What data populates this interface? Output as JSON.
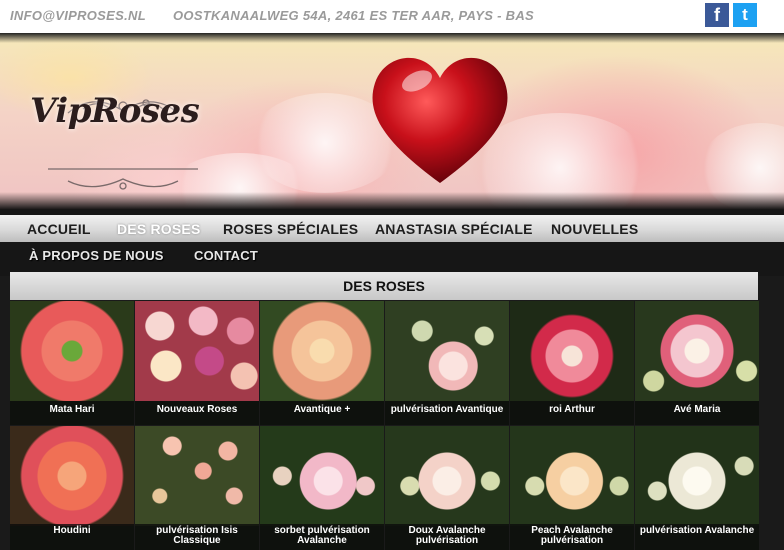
{
  "topbar": {
    "email": "INFO@VIPROSES.NL",
    "address": "OOSTKANAALWEG 54A, 2461 ES TER AAR, PAYS - BAS",
    "facebook_glyph": "f",
    "twitter_glyph": "t"
  },
  "brand": {
    "logo_text": "VipRoses"
  },
  "nav": {
    "row1": [
      "ACCUEIL",
      "DES ROSES",
      "ROSES SPÉCIALES",
      "ANASTASIA SPÉCIALE",
      "NOUVELLES"
    ],
    "row2": [
      "À PROPOS DE NOUS",
      "CONTACT"
    ],
    "active": "DES ROSES"
  },
  "section": {
    "title": "DES ROSES"
  },
  "products": [
    {
      "name": "Mata Hari"
    },
    {
      "name": "Nouveaux Roses"
    },
    {
      "name": "Avantique +"
    },
    {
      "name": "pulvérisation Avantique"
    },
    {
      "name": "roi Arthur"
    },
    {
      "name": "Avé Maria"
    },
    {
      "name": "Houdini"
    },
    {
      "name": "pulvérisation Isis Classique"
    },
    {
      "name": "sorbet pulvérisation Avalanche"
    },
    {
      "name": "Doux Avalanche pulvérisation"
    },
    {
      "name": "Peach Avalanche pulvérisation"
    },
    {
      "name": "pulvérisation Avalanche"
    }
  ],
  "colors": {
    "facebook": "#3b5998",
    "twitter": "#1da1f2",
    "nav_bar": "#d9d9d9",
    "title_bar": "#d6d6d6"
  }
}
